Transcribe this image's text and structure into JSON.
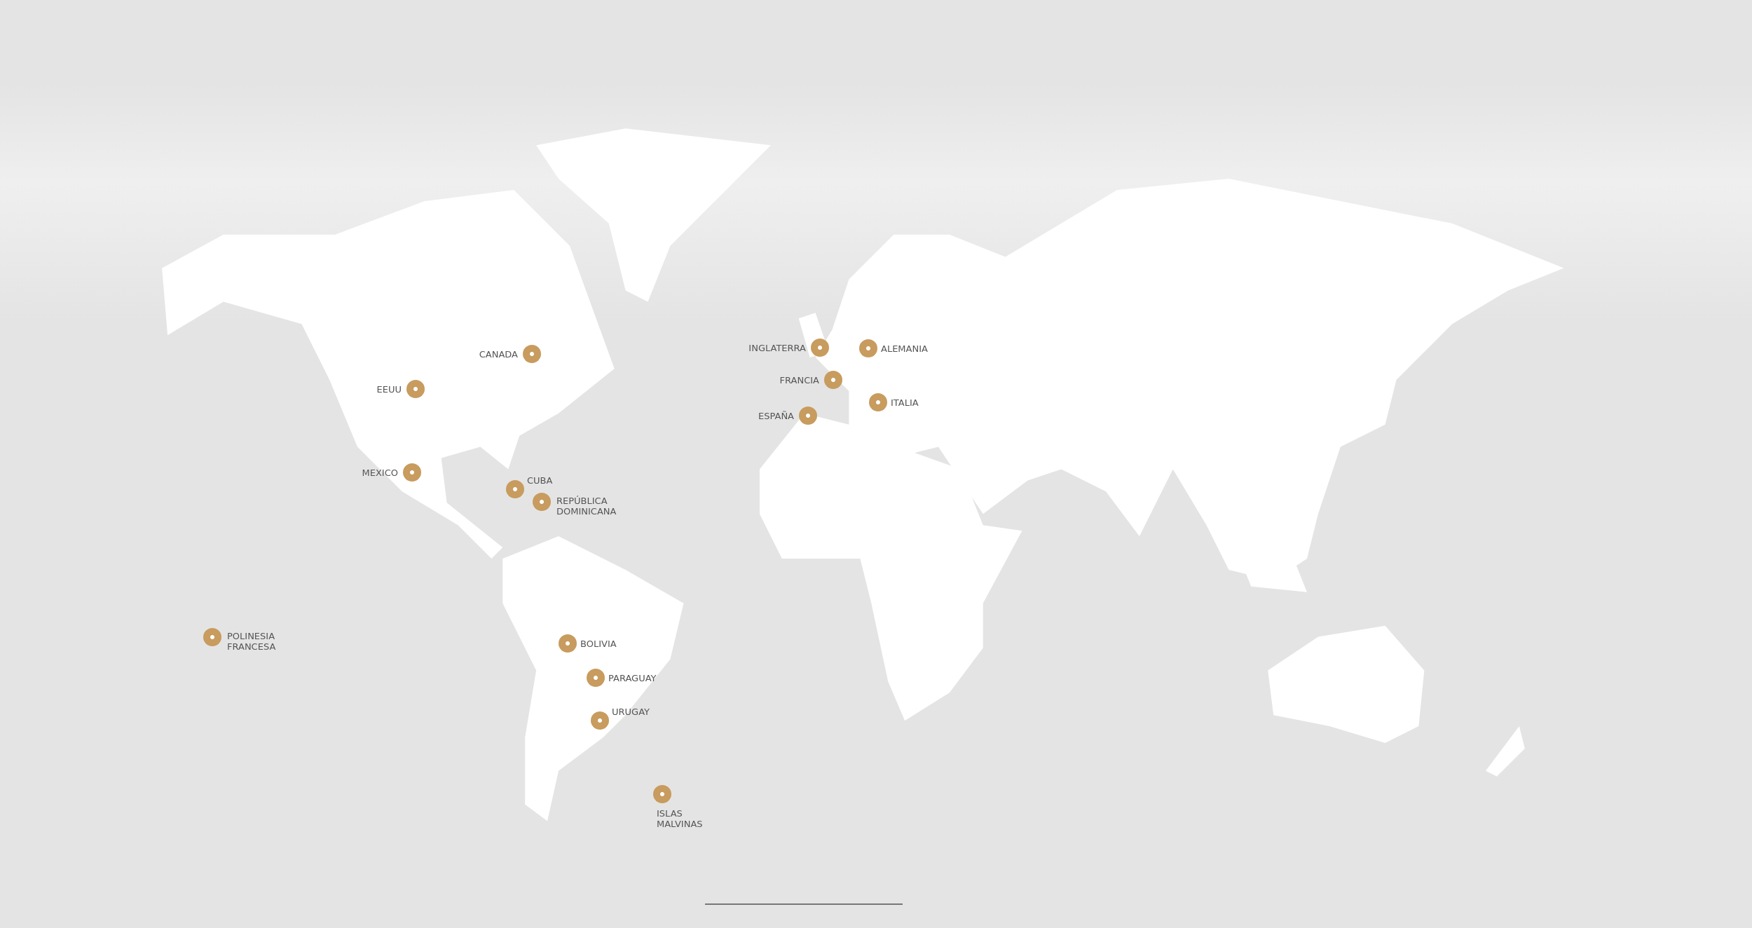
{
  "locations": [
    {
      "label": "CANADA"
    },
    {
      "label": "EEUU"
    },
    {
      "label": "MEXICO"
    },
    {
      "label": "CUBA"
    },
    {
      "label": "REPÚBLICA DOMINICANA"
    },
    {
      "label": "INGLATERRA"
    },
    {
      "label": "ALEMANIA"
    },
    {
      "label": "FRANCIA"
    },
    {
      "label": "ITALIA"
    },
    {
      "label": "ESPAÑA"
    },
    {
      "label": "POLINESIA FRANCESA"
    },
    {
      "label": "BOLIVIA"
    },
    {
      "label": "PARAGUAY"
    },
    {
      "label": "URUGAY"
    },
    {
      "label": "ISLAS MALVINAS"
    }
  ]
}
